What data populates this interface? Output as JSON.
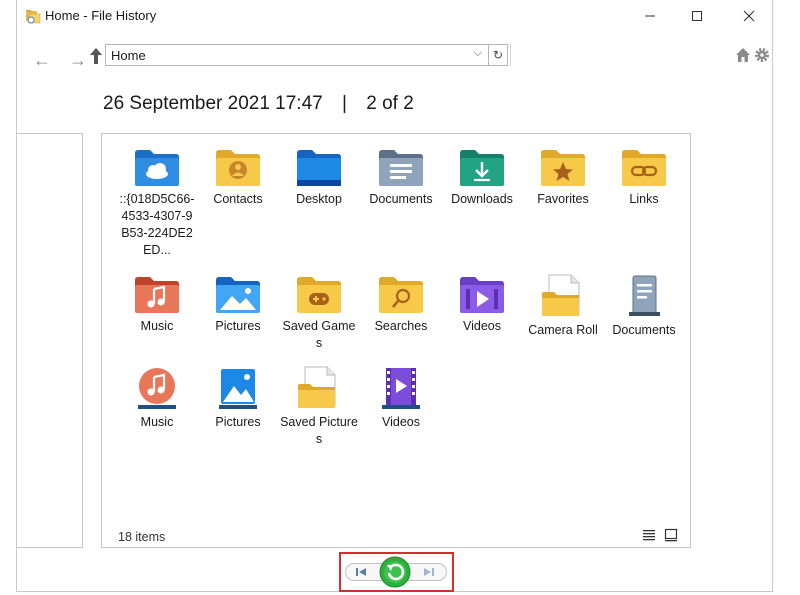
{
  "window": {
    "title": "Home - File History"
  },
  "toolbar": {
    "address": "Home",
    "back_icon": "back-arrow-icon",
    "forward_icon": "forward-arrow-icon",
    "up_icon": "up-arrow-icon"
  },
  "header": {
    "date": "26 September 2021 17:47",
    "separator": "|",
    "page": "2 of 2"
  },
  "files": [
    {
      "label": "::{018D5C66-4533-4307-9B53-224DE2ED...",
      "icon": "onedrive-folder-icon"
    },
    {
      "label": "Contacts",
      "icon": "contacts-folder-icon"
    },
    {
      "label": "Desktop",
      "icon": "desktop-folder-icon"
    },
    {
      "label": "Documents",
      "icon": "documents-folder-icon"
    },
    {
      "label": "Downloads",
      "icon": "downloads-folder-icon"
    },
    {
      "label": "Favorites",
      "icon": "favorites-folder-icon"
    },
    {
      "label": "Links",
      "icon": "links-folder-icon"
    },
    {
      "label": "Music",
      "icon": "music-folder-icon"
    },
    {
      "label": "Pictures",
      "icon": "pictures-folder-icon"
    },
    {
      "label": "Saved Games",
      "icon": "saved-games-folder-icon"
    },
    {
      "label": "Searches",
      "icon": "searches-folder-icon"
    },
    {
      "label": "Videos",
      "icon": "videos-folder-icon"
    },
    {
      "label": "Camera Roll",
      "icon": "camera-roll-folder-icon"
    },
    {
      "label": "Documents",
      "icon": "documents-library-icon"
    },
    {
      "label": "Music",
      "icon": "music-library-icon"
    },
    {
      "label": "Pictures",
      "icon": "pictures-library-icon"
    },
    {
      "label": "Saved Pictures",
      "icon": "saved-pictures-folder-icon"
    },
    {
      "label": "Videos",
      "icon": "videos-library-icon"
    }
  ],
  "status": {
    "items": "18 items"
  },
  "colors": {
    "highlight": "#d32f2f",
    "restore": "#2fae3e",
    "folder_yellow": "#f7c948"
  }
}
